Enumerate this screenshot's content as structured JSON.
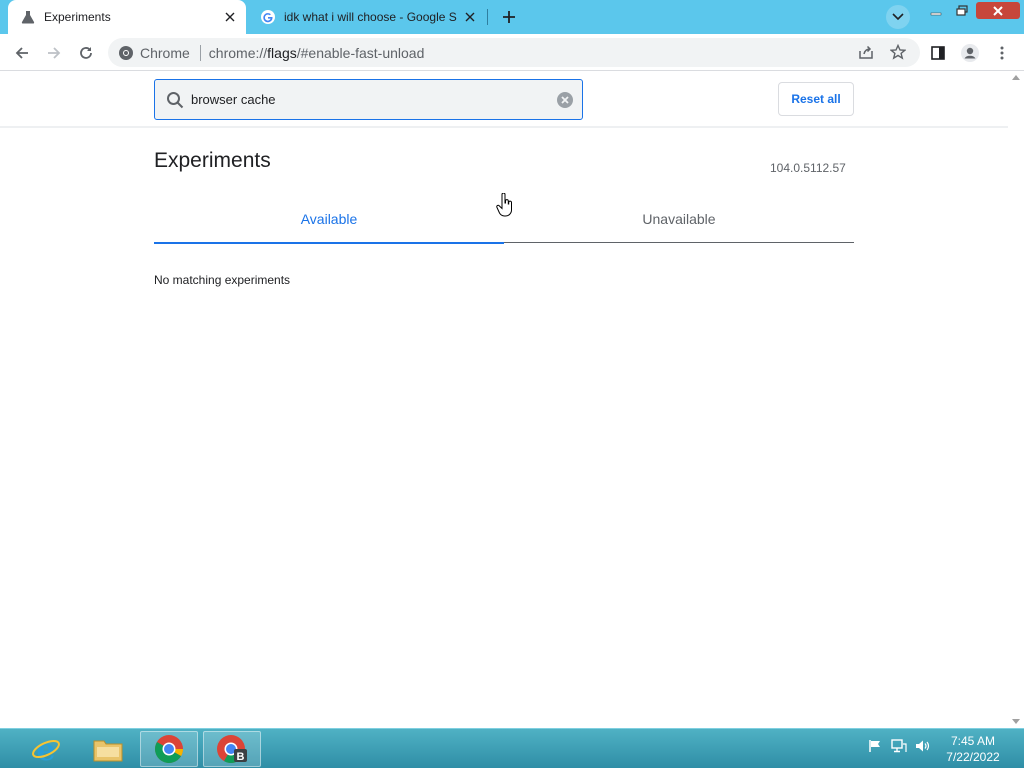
{
  "browser": {
    "tabs": [
      {
        "title": "Experiments",
        "active": true,
        "favicon": "flask-icon"
      },
      {
        "title": "idk what i will choose - Google S",
        "active": false,
        "favicon": "google-icon"
      }
    ],
    "address": {
      "site_label": "Chrome",
      "url_prefix": "chrome://",
      "url_host": "flags",
      "url_rest": "/#enable-fast-unload"
    }
  },
  "flags_page": {
    "search": {
      "value": "browser cache",
      "placeholder": "Search flags"
    },
    "reset_label": "Reset all",
    "title": "Experiments",
    "version": "104.0.5112.57",
    "tabs": [
      {
        "label": "Available",
        "selected": true
      },
      {
        "label": "Unavailable",
        "selected": false
      }
    ],
    "empty_message": "No matching experiments"
  },
  "taskbar": {
    "apps": [
      {
        "name": "internet-explorer-icon"
      },
      {
        "name": "file-explorer-icon"
      },
      {
        "name": "chrome-icon"
      },
      {
        "name": "chrome-profile-b-icon"
      }
    ],
    "clock": {
      "time": "7:45 AM",
      "date": "7/22/2022"
    }
  },
  "colors": {
    "accent": "#1a73e8",
    "tabstrip": "#5bc7ec",
    "taskbar": "#3a9db5"
  }
}
